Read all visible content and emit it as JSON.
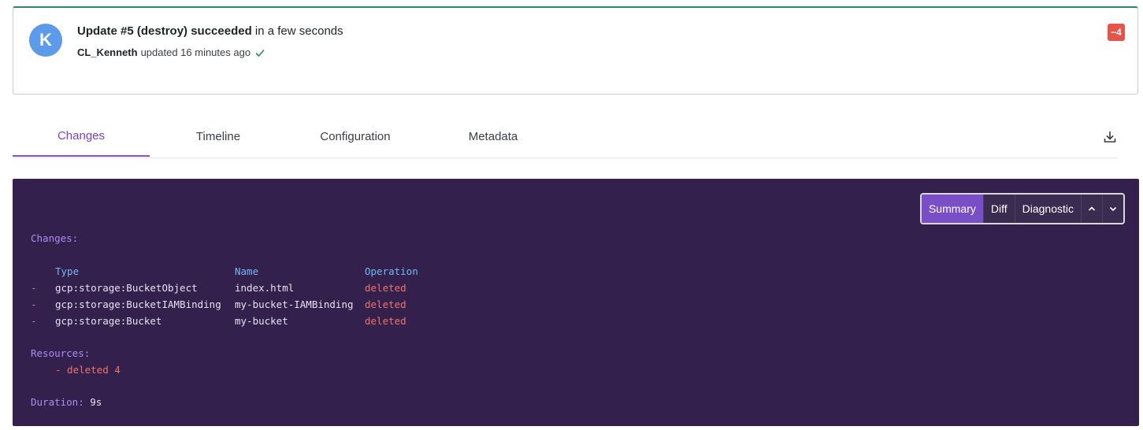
{
  "update": {
    "avatar_letter": "K",
    "title_bold": "Update #5 (destroy) succeeded",
    "title_rest": " in a few seconds",
    "user": "CL_Kenneth",
    "updated_text": "updated 16 minutes ago",
    "delta_badge": "−4",
    "success_color": "#2e8b57"
  },
  "tabs": [
    {
      "label": "Changes",
      "active": true
    },
    {
      "label": "Timeline",
      "active": false
    },
    {
      "label": "Configuration",
      "active": false
    },
    {
      "label": "Metadata",
      "active": false
    }
  ],
  "toolbar": {
    "summary": "Summary",
    "diff": "Diff",
    "diagnostic": "Diagnostic",
    "up_icon": "chevron-up-icon",
    "down_icon": "chevron-down-icon"
  },
  "output": {
    "changes_header": "Changes:",
    "columns": {
      "type": "Type",
      "name": "Name",
      "operation": "Operation"
    },
    "rows": [
      {
        "marker": "-",
        "type": "gcp:storage:BucketObject",
        "name": "index.html",
        "operation": "deleted"
      },
      {
        "marker": "-",
        "type": "gcp:storage:BucketIAMBinding",
        "name": "my-bucket-IAMBinding",
        "operation": "deleted"
      },
      {
        "marker": "-",
        "type": "gcp:storage:Bucket",
        "name": "my-bucket",
        "operation": "deleted"
      }
    ],
    "resources_header": "Resources:",
    "resources_line": "- deleted 4",
    "duration_label": "Duration:",
    "duration_value": "9s"
  }
}
